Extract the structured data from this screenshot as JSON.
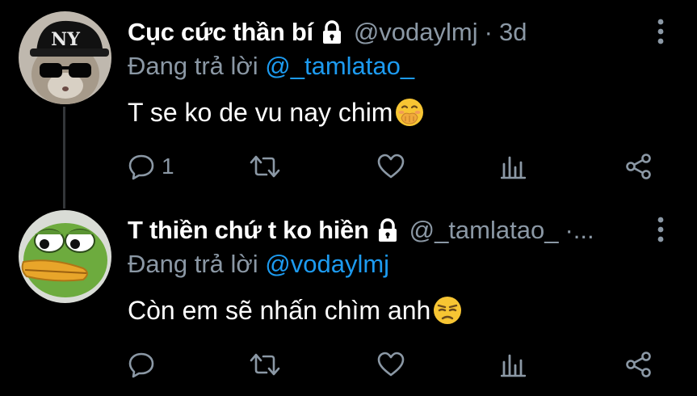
{
  "tweets": [
    {
      "display_name": "Cục cức thần bí",
      "handle": "@vodaylmj",
      "separator": "·",
      "time": "3d",
      "reply_prefix": "Đang trả lời",
      "reply_to": "@_tamlatao_",
      "text": "T se ko de vu nay chim",
      "emoji": "face-with-hand-over-mouth",
      "reply_count": "1",
      "avatar": "cat-with-ny-cap-and-sunglasses"
    },
    {
      "display_name": "T thiền chứ t ko hiền",
      "handle": "@_tamlatao_",
      "separator": "·...",
      "time": "",
      "reply_prefix": "Đang trả lời",
      "reply_to": "@vodaylmj",
      "text": "Còn em sẽ nhấn chìm anh",
      "emoji": "unamused-face",
      "reply_count": "",
      "avatar": "pepe-frog"
    }
  ],
  "colors": {
    "background": "#000000",
    "name": "#ffffff",
    "secondary": "#8b98a5",
    "mention": "#1d9bf0",
    "thread_line": "#333639"
  }
}
